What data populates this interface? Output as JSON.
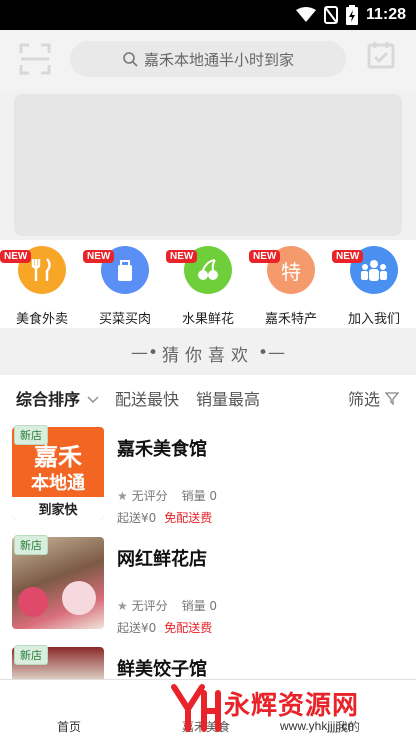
{
  "status_bar": {
    "time": "11:28"
  },
  "header": {
    "search_placeholder": "嘉禾本地通半小时到家",
    "scan_label": "扫一扫",
    "sign_label": "签到"
  },
  "categories": [
    {
      "label": "美食外卖",
      "tag": "NEW",
      "color": "#f7a628",
      "glyph": "🍴"
    },
    {
      "label": "买菜买肉",
      "tag": "NEW",
      "color": "#5a8ff5",
      "glyph": ""
    },
    {
      "label": "水果鲜花",
      "tag": "NEW",
      "color": "#6fcf3a",
      "glyph": ""
    },
    {
      "label": "嘉禾特产",
      "tag": "NEW",
      "color": "#f59a6c",
      "glyph": "特"
    },
    {
      "label": "加入我们",
      "tag": "NEW",
      "color": "#4a90f0",
      "glyph": ""
    }
  ],
  "guess_title": "猜你喜欢",
  "sort_bar": {
    "default": "综合排序",
    "fastest": "配送最快",
    "best_selling": "销量最高",
    "filter": "筛选"
  },
  "stores": [
    {
      "tag": "新店",
      "name": "嘉禾美食馆",
      "rating": "无评分",
      "sales": "销量 0",
      "min_order": "起送¥0",
      "delivery": "免配送费",
      "thumb_line1": "嘉禾",
      "thumb_line2": "本地通",
      "thumb_line3": "到家快"
    },
    {
      "tag": "新店",
      "name": "网红鲜花店",
      "rating": "无评分",
      "sales": "销量 0",
      "min_order": "起送¥0",
      "delivery": "免配送费"
    },
    {
      "tag": "新店",
      "name": "鲜美饺子馆"
    }
  ],
  "tabs": {
    "home": "首页",
    "food": "嘉禾美食",
    "mine": "我的"
  },
  "watermark": {
    "brand": "永辉资源网",
    "url": "www.yhkjjjj.cn"
  },
  "colors": {
    "accent_red": "#e8232a",
    "orange": "#f26522"
  }
}
